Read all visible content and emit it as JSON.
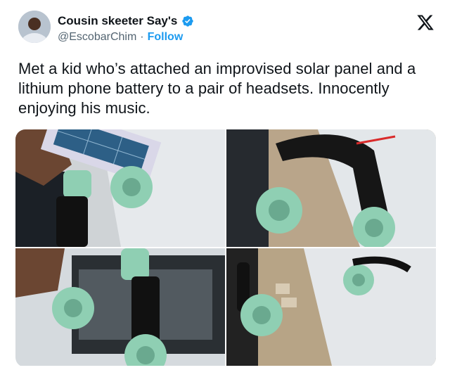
{
  "tweet": {
    "author_name": "Cousin skeeter Say's",
    "handle": "@EscobarChim",
    "separator": "·",
    "follow_label": "Follow",
    "text": "Met a kid who’s attached an improvised solar panel and a lithium phone battery to a pair of headsets. Innocently enjoying his music.",
    "photos": [
      "photo-1",
      "photo-2",
      "photo-3",
      "photo-4"
    ]
  },
  "colors": {
    "accent": "#1d9bf0",
    "text": "#0f1419",
    "secondary": "#536471",
    "headphone_mint": "#8fcfb3"
  }
}
